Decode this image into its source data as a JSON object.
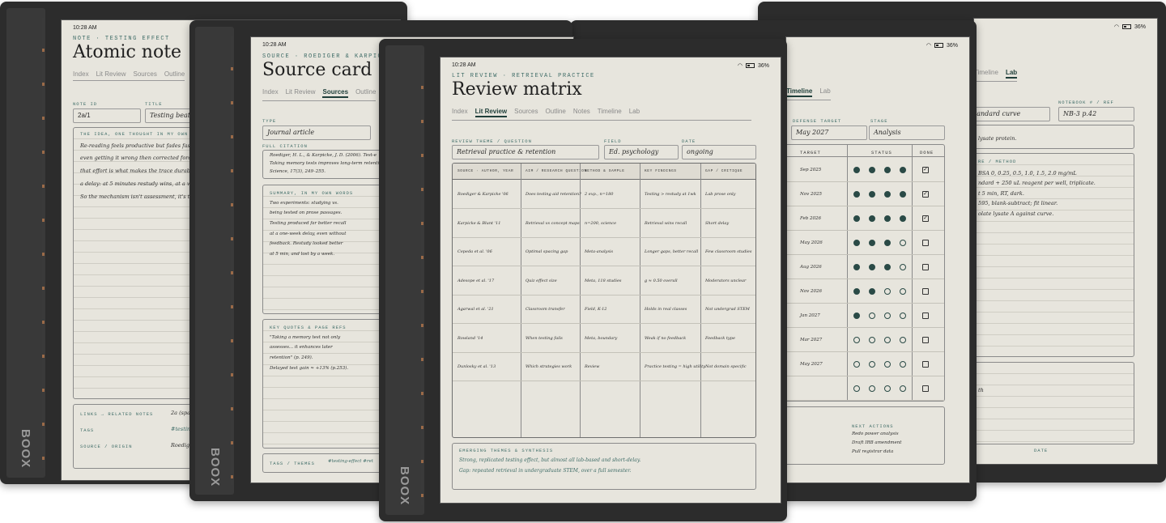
{
  "brand": "BOOX",
  "status_bar": {
    "time": "10:28 AM",
    "battery": "36%"
  },
  "atomic": {
    "eyebrow": "NOTE · TESTING EFFECT",
    "title": "Atomic note",
    "tabs": [
      "Index",
      "Lit Review",
      "Sources",
      "Outline"
    ],
    "note_id_label": "NOTE ID",
    "note_id": "2a/1",
    "title_label": "TITLE",
    "title_value": "Testing beats",
    "idea_label": "THE IDEA, ONE THOUGHT IN MY OWN W",
    "idea_lines": [
      "Re-reading feels productive but fades fast. Re",
      "even getting it wrong then corrected forces re",
      "that effort is what makes the trace durable.",
      "a delay: at 5 minutes restudy wins, at a week",
      "So the mechanism isn't assessment, it's the u"
    ],
    "links_label": "LINKS → RELATED NOTES",
    "links_value": "2a (spac",
    "tags_label": "TAGS",
    "tags_value": "#testing",
    "source_label": "SOURCE / ORIGIN",
    "source_value": "Roediger"
  },
  "source": {
    "eyebrow": "SOURCE · ROEDIGER & KARPICKE",
    "title": "Source card",
    "tabs": [
      "Index",
      "Lit Review",
      "Sources",
      "Outline"
    ],
    "active_tab": "Sources",
    "type_label": "TYPE",
    "type_value": "Journal article",
    "citation_label": "FULL CITATION",
    "citation_lines": [
      "Roediger, H. L., & Karpicke, J. D. (2006). Test-e",
      "Taking memory tests improves long-term retention",
      "Science, 17(3), 249–255."
    ],
    "summary_label": "SUMMARY, IN MY OWN WORDS",
    "summary_lines": [
      "Two experiments: studying vs.",
      "being tested on prose passages.",
      "Testing produced far better recall",
      "at a one-week delay, even without",
      "feedback. Restudy looked better",
      "at 5 min, and lost by a week."
    ],
    "quotes_label": "KEY QUOTES & PAGE REFS",
    "quotes_lines": [
      "\"Taking a memory test not only",
      "assesses... it enhances later",
      "retention\" (p. 249).",
      "Delayed test gain ≈ +13% (p.253)."
    ],
    "tags_label": "TAGS / THEMES",
    "tags_value": "#testing-effect  #ret"
  },
  "lab": {
    "defense_label": "DEFENSE TARGET",
    "defense_value": "May 2027",
    "stage_label": "STAGE",
    "stage_value": "Analysis",
    "tabs": [
      "Timeline",
      "Lab"
    ],
    "date_header": "TARGET",
    "status_header": "STATUS",
    "done_header": "DONE",
    "rows": [
      {
        "date": "Sep 2025",
        "on": 4,
        "done": true
      },
      {
        "date": "Nov 2025",
        "on": 4,
        "done": true
      },
      {
        "date": "Feb 2026",
        "on": 4,
        "done": true
      },
      {
        "date": "May 2026",
        "on": 3,
        "done": false
      },
      {
        "date": "Aug 2026",
        "on": 3,
        "done": false
      },
      {
        "date": "Nov 2026",
        "on": 2,
        "done": false
      },
      {
        "date": "Jan 2027",
        "on": 1,
        "done": false
      },
      {
        "date": "Mar 2027",
        "on": 0,
        "done": false
      },
      {
        "date": "May 2027",
        "on": 0,
        "done": false
      },
      {
        "date": "",
        "on": 0,
        "done": false
      }
    ],
    "next_label": "NEXT ACTIONS",
    "next_items": [
      "Redo power analysis",
      "Draft IRB amendment",
      "Pull registrar data"
    ]
  },
  "protocol": {
    "tabs": [
      "Timeline",
      "Lab"
    ],
    "active_tab": "Lab",
    "title_value": "tandard curve",
    "notebook_label": "NOTEBOOK # / REF",
    "notebook_value": "NB-3 p.42",
    "purpose_line": "lysate protein.",
    "method_label": "RE / METHOD",
    "method_lines": [
      "BSA 0, 0.25, 0.5, 1.0, 1.5, 2.0 mg/mL",
      "ndard + 250 uL reagent per well, triplicate.",
      "t 5 min, RT, dark.",
      "595, blank-subtract; fit linear.",
      "olate lysate A against curve."
    ],
    "obs_line": "th",
    "date_label": "DATE"
  },
  "review": {
    "eyebrow": "LIT REVIEW · RETRIEVAL PRACTICE",
    "title": "Review matrix",
    "tabs": [
      "Index",
      "Lit Review",
      "Sources",
      "Outline",
      "Notes",
      "Timeline",
      "Lab"
    ],
    "active_tab": "Lit Review",
    "theme_label": "REVIEW THEME / QUESTION",
    "theme_value": "Retrieval practice & retention",
    "field_label": "FIELD",
    "field_value": "Ed. psychology",
    "date_label": "DATE",
    "date_value": "ongoing",
    "columns": [
      "SOURCE · AUTHOR, YEAR",
      "AIM / RESEARCH QUESTION",
      "METHOD & SAMPLE",
      "KEY FINDINGS",
      "GAP / CRITIQUE"
    ],
    "rows": [
      [
        "Roediger & Karpicke '06",
        "Does testing aid retention?",
        "2 exp., n=180",
        "Testing > restudy at 1wk",
        "Lab prose only"
      ],
      [
        "Karpicke & Blunt '11",
        "Retrieval vs concept maps",
        "n=200, science",
        "Retrieval wins recall",
        "Short delay"
      ],
      [
        "Cepeda et al. '06",
        "Optimal spacing gap",
        "Meta-analysis",
        "Longer gaps, better recall",
        "Few classroom studies"
      ],
      [
        "Adesope et al. '17",
        "Quiz effect size",
        "Meta, 118 studies",
        "g ≈ 0.50 overall",
        "Moderators unclear"
      ],
      [
        "Agarwal et al. '21",
        "Classroom transfer",
        "Field, K-12",
        "Holds in real classes",
        "Not undergrad STEM"
      ],
      [
        "Rowland '14",
        "When testing fails",
        "Meta, boundary",
        "Weak if no feedback",
        "Feedback type"
      ],
      [
        "Dunlosky et al. '13",
        "Which strategies work",
        "Review",
        "Practice testing = high utility",
        "Not domain specific"
      ]
    ],
    "synthesis_label": "EMERGING THEMES & SYNTHESIS",
    "synthesis_lines": [
      "Strong, replicated testing effect, but almost all lab-based and short-delay.",
      "Gap: repeated retrieval in undergraduate STEM, over a full semester."
    ]
  }
}
